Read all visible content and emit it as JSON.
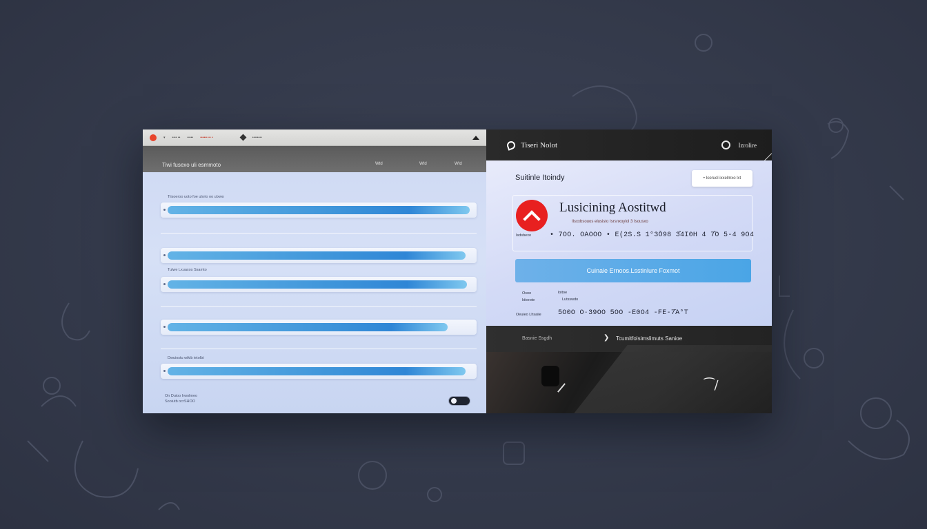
{
  "left_panel": {
    "titlebar": {
      "item1": "▾",
      "item2": "•••• ••",
      "item3": "•••••",
      "item4": "•••••• •• •",
      "item5": "••••••••"
    },
    "header": {
      "title": "Tiwi fusexo uli esmmoto",
      "col1": "Wtd",
      "col2": "Wtd",
      "col3": "Wtd"
    },
    "rows": [
      {
        "label": "Tiisoeroo uoto foe ulxrio oo ulxwo"
      },
      {
        "label": ""
      },
      {
        "label": "Tulwe  Lxuaxos Ssamto"
      },
      {
        "label": ""
      },
      {
        "label": ""
      },
      {
        "label": "Dwuiostu wikib ietolbt"
      }
    ],
    "footer": {
      "line1": "On Duioo Irwolmeo",
      "line2": "Sooiutb ocrSHOO"
    }
  },
  "right_panel": {
    "topbar": {
      "title": "Tiseri Nolot",
      "action": "Izrolire"
    },
    "card": {
      "heading": "Suitinle Itoindy",
      "button": "• Icoruol ixxelmxo lxt",
      "name": "Lusicining Aostitwd",
      "subtitle": "Ilsxxbsouos elusisto Isrsnxoyiol 3 Isousxo",
      "label1": "Isdsbexo",
      "value1": "• 7OO. OAOOO  •  E(2S.S 1°3Ō98 3̂4I0H 4 7̂O 5-4 9O4",
      "primary_button": "Cuinaie Ernoos.Lsstinlure Foxmot",
      "label2a": "Osoo",
      "label2b": "loitoe",
      "label2c": "Idoeote",
      "label2d": "Lutsswdo",
      "label2e": "Oeuieo Lhsaiie",
      "value2": "5O0O  O·39OO   5OO  -E0O4  -FE-7̄A°T"
    },
    "bottom_bar": {
      "left": "Basnie Ssgdh",
      "arrow": "❯",
      "right": "Tcumitfolsimslimuts Sanioe"
    }
  },
  "colors": {
    "accent": "#4aa5e6",
    "brand": "#e82020",
    "dark": "#1f1f1f"
  }
}
